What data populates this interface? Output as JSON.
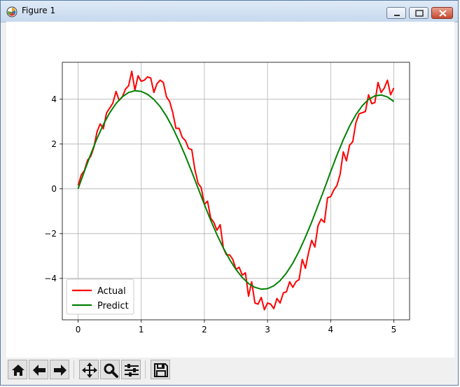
{
  "window": {
    "title": "Figure 1",
    "icons": {
      "app": "matplotlib-icon",
      "minimize": "minimize-icon",
      "maximize": "maximize-icon",
      "close": "close-icon"
    }
  },
  "toolbar": {
    "buttons": [
      {
        "name": "home-button",
        "icon": "home-icon"
      },
      {
        "name": "back-button",
        "icon": "arrow-left-icon"
      },
      {
        "name": "forward-button",
        "icon": "arrow-right-icon"
      },
      {
        "name": "pan-button",
        "icon": "move-icon"
      },
      {
        "name": "zoom-button",
        "icon": "magnifier-icon"
      },
      {
        "name": "configure-subplots-button",
        "icon": "sliders-icon"
      },
      {
        "name": "save-button",
        "icon": "floppy-disk-icon"
      }
    ]
  },
  "chart_data": {
    "type": "line",
    "title": "",
    "xlabel": "",
    "ylabel": "",
    "xlim": [
      -0.25,
      5.25
    ],
    "ylim": [
      -5.85,
      5.65
    ],
    "xticks": [
      0,
      1,
      2,
      3,
      4,
      5
    ],
    "xtick_labels": [
      "0",
      "1",
      "2",
      "3",
      "4",
      "5"
    ],
    "yticks": [
      -4,
      -2,
      0,
      2,
      4
    ],
    "ytick_labels": [
      "−4",
      "−2",
      "0",
      "2",
      "4"
    ],
    "grid": true,
    "legend_position": "lower-left",
    "series": [
      {
        "name": "Actual",
        "color": "#ff0000",
        "x": [
          0.0,
          0.05,
          0.1,
          0.15,
          0.2,
          0.25,
          0.3,
          0.35,
          0.4,
          0.45,
          0.5,
          0.55,
          0.6,
          0.65,
          0.7,
          0.75,
          0.8,
          0.85,
          0.9,
          0.95,
          1.0,
          1.05,
          1.1,
          1.15,
          1.2,
          1.25,
          1.3,
          1.35,
          1.4,
          1.45,
          1.5,
          1.55,
          1.6,
          1.65,
          1.7,
          1.75,
          1.8,
          1.85,
          1.9,
          1.95,
          2.0,
          2.05,
          2.1,
          2.15,
          2.2,
          2.25,
          2.3,
          2.35,
          2.4,
          2.45,
          2.5,
          2.55,
          2.6,
          2.65,
          2.7,
          2.75,
          2.8,
          2.85,
          2.9,
          2.95,
          3.0,
          3.05,
          3.1,
          3.15,
          3.2,
          3.25,
          3.3,
          3.35,
          3.4,
          3.45,
          3.5,
          3.55,
          3.6,
          3.65,
          3.7,
          3.75,
          3.8,
          3.85,
          3.9,
          3.95,
          4.0,
          4.05,
          4.1,
          4.15,
          4.2,
          4.25,
          4.3,
          4.35,
          4.4,
          4.45,
          4.5,
          4.55,
          4.6,
          4.65,
          4.7,
          4.75,
          4.8,
          4.85,
          4.9,
          4.95,
          5.0
        ],
        "y": [
          0.15,
          0.62,
          0.82,
          1.28,
          1.45,
          1.85,
          2.55,
          2.9,
          2.68,
          3.38,
          3.6,
          3.82,
          4.35,
          3.95,
          4.1,
          4.45,
          4.6,
          5.25,
          4.4,
          5.05,
          4.8,
          4.85,
          5.0,
          4.95,
          4.3,
          4.7,
          4.85,
          4.75,
          4.1,
          3.9,
          3.4,
          2.7,
          2.7,
          2.3,
          2.15,
          1.8,
          1.75,
          0.85,
          0.25,
          0.05,
          -0.7,
          -0.55,
          -1.3,
          -1.5,
          -1.85,
          -1.6,
          -2.65,
          -2.95,
          -2.95,
          -3.15,
          -3.6,
          -3.5,
          -3.85,
          -3.75,
          -4.8,
          -4.15,
          -5.1,
          -5.15,
          -4.85,
          -5.4,
          -5.1,
          -5.15,
          -5.35,
          -4.9,
          -5.1,
          -4.65,
          -4.6,
          -4.15,
          -4.4,
          -4.15,
          -4.05,
          -3.15,
          -3.55,
          -2.85,
          -2.3,
          -2.6,
          -1.65,
          -1.35,
          -1.5,
          -0.4,
          -0.35,
          -0.05,
          0.15,
          0.65,
          1.65,
          1.25,
          1.95,
          2.1,
          2.95,
          3.35,
          3.4,
          3.45,
          4.2,
          3.8,
          3.85,
          4.75,
          4.3,
          4.5,
          4.85,
          4.2,
          4.5
        ],
        "x_note": "x sampled every 0.05 from 0 to 5"
      },
      {
        "name": "Predict",
        "color": "#008000",
        "x": [
          0.0,
          0.1,
          0.2,
          0.3,
          0.4,
          0.5,
          0.6,
          0.7,
          0.8,
          0.9,
          1.0,
          1.1,
          1.2,
          1.3,
          1.4,
          1.5,
          1.6,
          1.7,
          1.8,
          1.9,
          2.0,
          2.1,
          2.2,
          2.3,
          2.4,
          2.5,
          2.6,
          2.7,
          2.8,
          2.9,
          3.0,
          3.1,
          3.2,
          3.3,
          3.4,
          3.5,
          3.6,
          3.7,
          3.8,
          3.9,
          4.0,
          4.1,
          4.2,
          4.3,
          4.4,
          4.5,
          4.6,
          4.7,
          4.8,
          4.9,
          5.0
        ],
        "y": [
          0.0,
          0.79,
          1.54,
          2.25,
          2.87,
          3.39,
          3.81,
          4.11,
          4.3,
          4.38,
          4.35,
          4.22,
          3.99,
          3.67,
          3.24,
          2.72,
          2.12,
          1.46,
          0.76,
          0.03,
          -0.7,
          -1.4,
          -2.05,
          -2.64,
          -3.16,
          -3.6,
          -3.96,
          -4.23,
          -4.4,
          -4.48,
          -4.46,
          -4.33,
          -4.1,
          -3.76,
          -3.32,
          -2.78,
          -2.16,
          -1.48,
          -0.75,
          0.0,
          0.77,
          1.51,
          2.19,
          2.8,
          3.31,
          3.71,
          3.99,
          4.15,
          4.19,
          4.1,
          3.9
        ]
      }
    ]
  }
}
